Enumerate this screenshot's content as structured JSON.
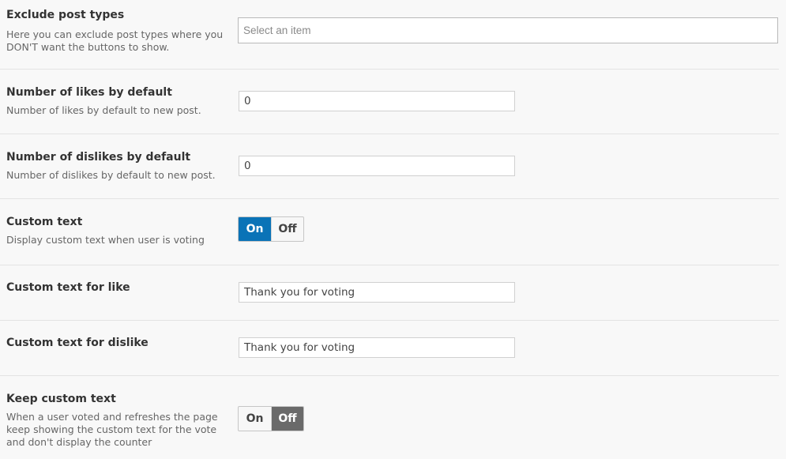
{
  "settings": {
    "exclude_post_types": {
      "title": "Exclude post types",
      "description": "Here you can exclude post types where you DON'T want the buttons to show.",
      "placeholder": "Select an item"
    },
    "likes_default": {
      "title": "Number of likes by default",
      "description": "Number of likes by default to new post.",
      "value": "0"
    },
    "dislikes_default": {
      "title": "Number of dislikes by default",
      "description": "Number of dislikes by default to new post.",
      "value": "0"
    },
    "custom_text": {
      "title": "Custom text",
      "description": "Display custom text when user is voting",
      "on_label": "On",
      "off_label": "Off",
      "selected": "On"
    },
    "custom_text_like": {
      "title": "Custom text for like",
      "value": "Thank you for voting"
    },
    "custom_text_dislike": {
      "title": "Custom text for dislike",
      "value": "Thank you for voting"
    },
    "keep_custom_text": {
      "title": "Keep custom text",
      "description": "When a user voted and refreshes the page keep showing the custom text for the vote and don't display the counter",
      "on_label": "On",
      "off_label": "Off",
      "selected": "Off"
    }
  },
  "colors": {
    "background": "#f8f8f8",
    "switch_active_on": "#0a73b7",
    "switch_active_off": "#6a6a6a"
  }
}
